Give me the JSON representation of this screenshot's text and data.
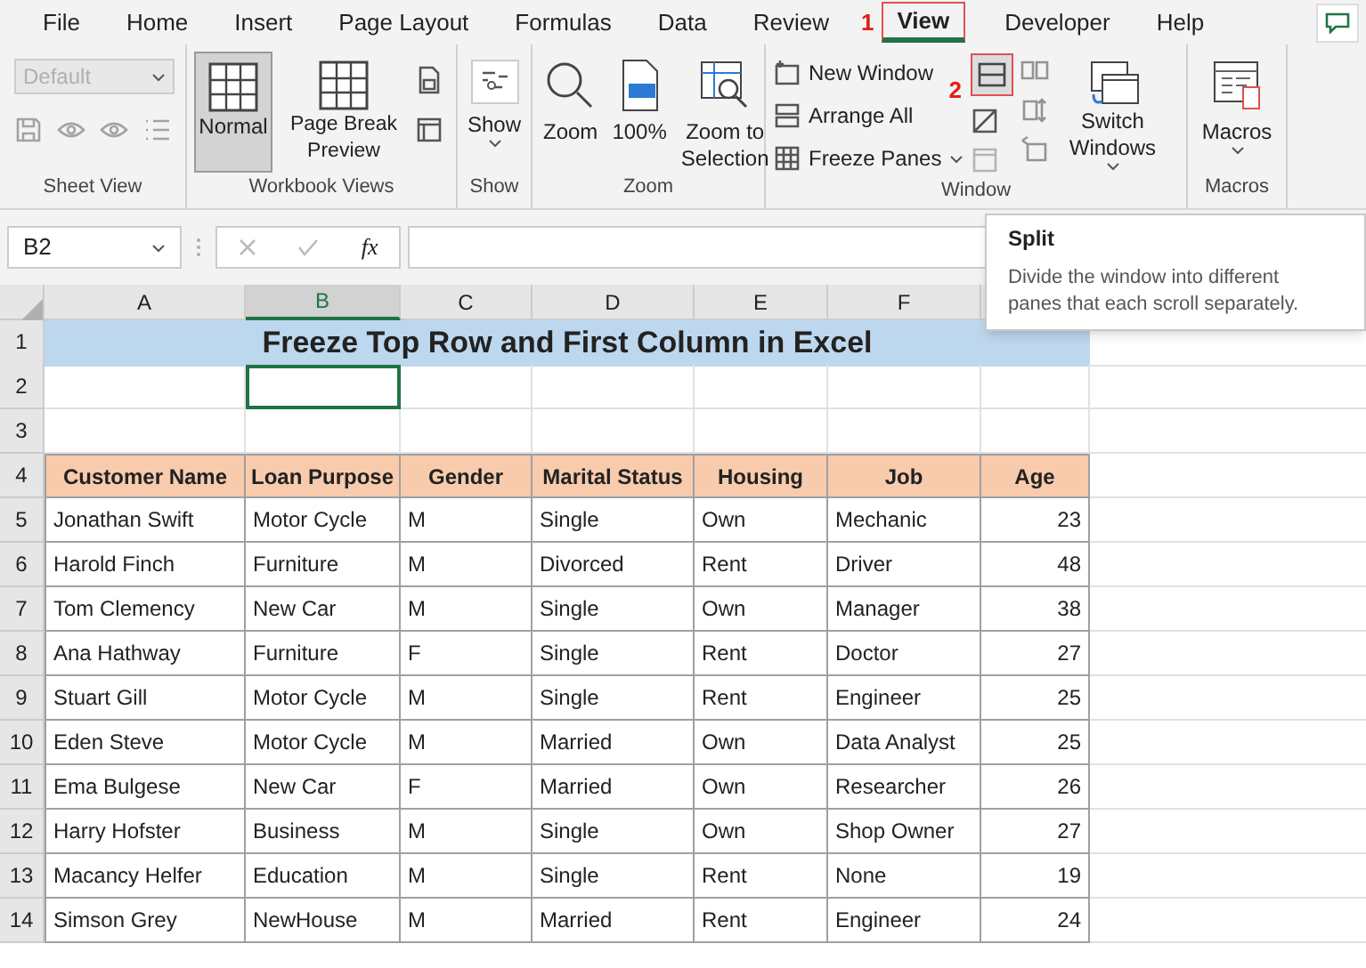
{
  "menu_tabs": [
    {
      "label": "File",
      "selected": false
    },
    {
      "label": "Home",
      "selected": false
    },
    {
      "label": "Insert",
      "selected": false
    },
    {
      "label": "Page Layout",
      "selected": false
    },
    {
      "label": "Formulas",
      "selected": false
    },
    {
      "label": "Data",
      "selected": false
    },
    {
      "label": "Review",
      "selected": false
    },
    {
      "label": "View",
      "selected": true
    },
    {
      "label": "Developer",
      "selected": false
    },
    {
      "label": "Help",
      "selected": false
    }
  ],
  "step_markers": [
    "1",
    "2"
  ],
  "ribbon": {
    "sheet_view": {
      "label": "Sheet View",
      "dropdown": {
        "value": "Default",
        "disabled": true
      }
    },
    "workbook_views": {
      "label": "Workbook Views",
      "buttons": [
        {
          "label": "Normal",
          "selected": true
        },
        {
          "label": "Page Break Preview",
          "selected": false
        }
      ]
    },
    "show": {
      "label": "Show",
      "button": "Show"
    },
    "zoom": {
      "label": "Zoom",
      "buttons": [
        "Zoom",
        "100%",
        "Zoom to Selection"
      ]
    },
    "window": {
      "label": "Window",
      "small_buttons": [
        "New Window",
        "Arrange All",
        "Freeze Panes"
      ],
      "switch": "Switch Windows"
    },
    "macros": {
      "label": "Macros",
      "button": "Macros"
    }
  },
  "formula_bar": {
    "name_box": "B2",
    "function_button": "fx"
  },
  "tooltip": {
    "title": "Split",
    "text": "Divide the window into different panes that each scroll separately."
  },
  "sheet": {
    "columns": [
      {
        "label": "A",
        "selected": false
      },
      {
        "label": "B",
        "selected": true
      },
      {
        "label": "C",
        "selected": false
      },
      {
        "label": "D",
        "selected": false
      },
      {
        "label": "E",
        "selected": false
      },
      {
        "label": "F",
        "selected": false
      }
    ],
    "row_numbers": [
      "1",
      "2",
      "3",
      "4",
      "5",
      "6",
      "7",
      "8",
      "9",
      "10",
      "11",
      "12",
      "13",
      "14"
    ],
    "title": "Freeze Top Row and First Column in Excel",
    "headers": [
      "Customer Name",
      "Loan Purpose",
      "Gender",
      "Marital Status",
      "Housing",
      "Job",
      "Age"
    ],
    "rows": [
      [
        "Jonathan Swift",
        "Motor Cycle",
        "M",
        "Single",
        "Own",
        "Mechanic",
        "23"
      ],
      [
        "Harold Finch",
        "Furniture",
        "M",
        "Divorced",
        "Rent",
        "Driver",
        "48"
      ],
      [
        "Tom Clemency",
        "New Car",
        "M",
        "Single",
        "Own",
        "Manager",
        "38"
      ],
      [
        "Ana Hathway",
        "Furniture",
        "F",
        "Single",
        "Rent",
        "Doctor",
        "27"
      ],
      [
        "Stuart Gill",
        "Motor Cycle",
        "M",
        "Single",
        "Rent",
        "Engineer",
        "25"
      ],
      [
        "Eden Steve",
        "Motor Cycle",
        "M",
        "Married",
        "Own",
        "Data Analyst",
        "25"
      ],
      [
        "Ema Bulgese",
        "New Car",
        "F",
        "Married",
        "Own",
        "Researcher",
        "26"
      ],
      [
        "Harry Hofster",
        "Business",
        "M",
        "Single",
        "Own",
        "Shop Owner",
        "27"
      ],
      [
        "Macancy Helfer",
        "Education",
        "M",
        "Single",
        "Rent",
        "None",
        "19"
      ],
      [
        "Simson Grey",
        "NewHouse",
        "M",
        "Married",
        "Rent",
        "Engineer",
        "24"
      ]
    ]
  }
}
